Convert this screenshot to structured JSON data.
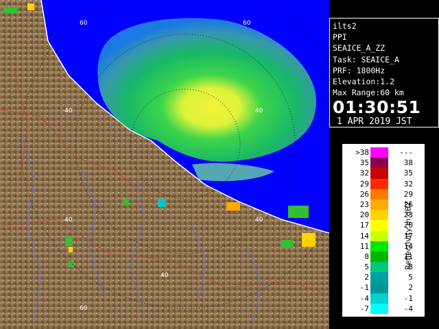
{
  "radar_panel": {
    "range_ring_labels": [
      "60",
      "60",
      "40",
      "40",
      "40",
      "40",
      "40",
      "60"
    ]
  },
  "info": {
    "site": "ilts2",
    "scan_type": "PPI",
    "product": "SEAICE_A_ZZ",
    "task": "Task: SEAICE_A",
    "prf": "PRF: 1800Hz",
    "elevation": "Elevation:1.2",
    "max_range": "Max Range:60 km",
    "time": "01:30:51",
    "date": "1 APR 2019 JST"
  },
  "legend": {
    "unit_label": "Reflectivity in dBZ",
    "rows": [
      {
        "lo": ">38",
        "hi": "---",
        "color": "#ff00ff"
      },
      {
        "lo": "35",
        "hi": "38",
        "color": "#8c0050"
      },
      {
        "lo": "32",
        "hi": "35",
        "color": "#c80000"
      },
      {
        "lo": "29",
        "hi": "32",
        "color": "#ff2a00"
      },
      {
        "lo": "26",
        "hi": "29",
        "color": "#ff7800"
      },
      {
        "lo": "23",
        "hi": "26",
        "color": "#ffaa00"
      },
      {
        "lo": "20",
        "hi": "23",
        "color": "#ffd200"
      },
      {
        "lo": "17",
        "hi": "20",
        "color": "#ffff00"
      },
      {
        "lo": "14",
        "hi": "17",
        "color": "#c8ff00"
      },
      {
        "lo": "11",
        "hi": "14",
        "color": "#00e600"
      },
      {
        "lo": "8",
        "hi": "11",
        "color": "#00b400"
      },
      {
        "lo": "5",
        "hi": "8",
        "color": "#00c878"
      },
      {
        "lo": "2",
        "hi": "5",
        "color": "#00a0a0"
      },
      {
        "lo": "-1",
        "hi": "2",
        "color": "#009696"
      },
      {
        "lo": "-4",
        "hi": "-1",
        "color": "#00d2d2"
      },
      {
        "lo": "-7",
        "hi": "-4",
        "color": "#00ffff"
      }
    ]
  }
}
